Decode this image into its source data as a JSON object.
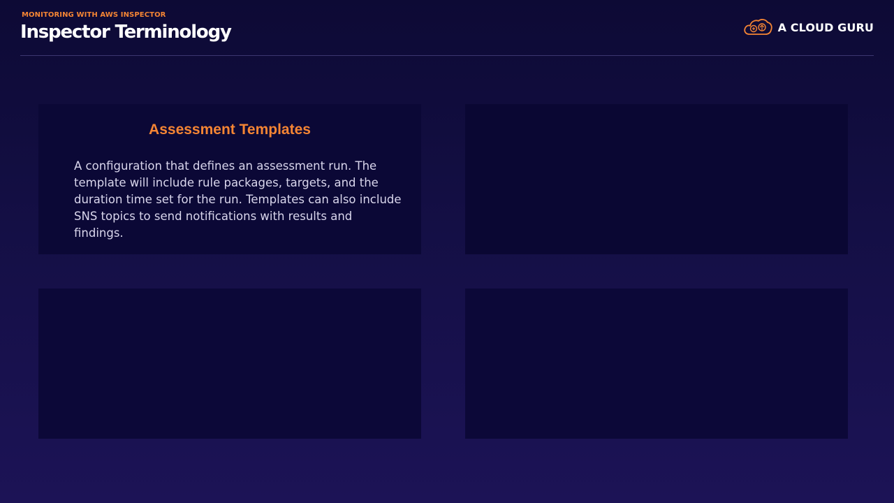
{
  "header": {
    "eyebrow": "MONITORING WITH AWS INSPECTOR",
    "title": "Inspector Terminology"
  },
  "brand": {
    "name": "A CLOUD GURU",
    "logo_icon": "cloud-logo-icon",
    "accent_color": "#f58534"
  },
  "cards": [
    {
      "title": "Assessment Templates",
      "body": "A configuration that defines an assessment run. The template will include rule packages, targets, and the duration time set for the run. Templates can also include SNS topics to send notifications with results and findings."
    },
    {
      "title": "",
      "body": ""
    },
    {
      "title": "",
      "body": ""
    },
    {
      "title": "",
      "body": ""
    }
  ],
  "colors": {
    "background_top": "#0d0a35",
    "background_bottom": "#1c1356",
    "card": "#0b0836",
    "title_accent": "#f58534",
    "body_text": "#d9d6ec"
  }
}
